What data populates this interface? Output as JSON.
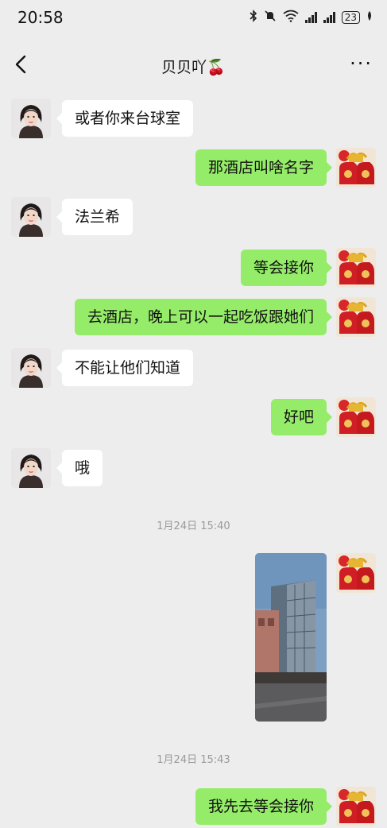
{
  "status_bar": {
    "time": "20:58",
    "battery": "23"
  },
  "header": {
    "title": "贝贝吖🍒",
    "more": "···"
  },
  "messages": [
    {
      "side": "left",
      "text": "或者你来台球室"
    },
    {
      "side": "right",
      "text": "那酒店叫啥名字"
    },
    {
      "side": "left",
      "text": "法兰希"
    },
    {
      "side": "right",
      "text": "等会接你"
    },
    {
      "side": "right",
      "text": "去酒店，晚上可以一起吃饭跟她们"
    },
    {
      "side": "left",
      "text": "不能让他们知道"
    },
    {
      "side": "right",
      "text": "好吧"
    },
    {
      "side": "left",
      "text": "哦"
    },
    {
      "side": "right",
      "text": "我先去等会接你"
    }
  ],
  "timestamps": [
    "1月24日 15:40",
    "1月24日 15:43"
  ]
}
